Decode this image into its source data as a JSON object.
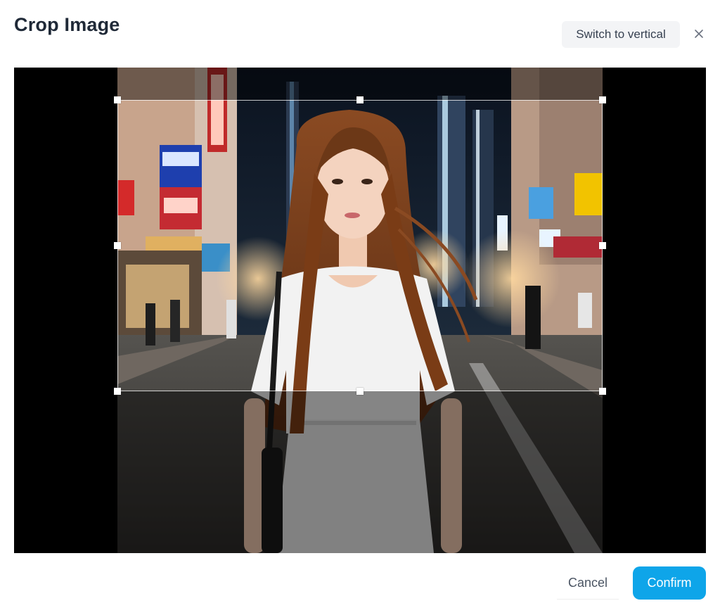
{
  "dialog": {
    "title": "Crop Image",
    "switch_label": "Switch to vertical",
    "close_icon": "close-icon"
  },
  "image": {
    "subject": "photo-woman-city-street-night"
  },
  "footer": {
    "cancel_label": "Cancel",
    "confirm_label": "Confirm"
  },
  "colors": {
    "accent": "#0ea5e9",
    "title": "#1f2937",
    "secondary_bg": "#f3f4f6"
  }
}
